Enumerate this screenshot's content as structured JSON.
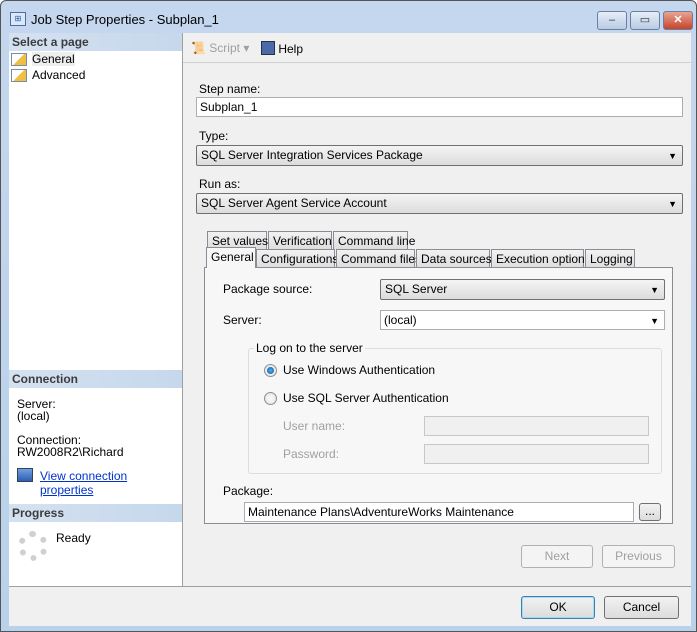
{
  "window": {
    "title": "Job Step Properties - Subplan_1",
    "controls": {
      "minimize": "–",
      "maximize": "▭",
      "close": "✕"
    }
  },
  "sidebar": {
    "select_header": "Select a page",
    "pages": [
      {
        "label": "General"
      },
      {
        "label": "Advanced"
      }
    ],
    "connection_header": "Connection",
    "server_label": "Server:",
    "server_value": "(local)",
    "connection_label": "Connection:",
    "connection_value": "RW2008R2\\Richard",
    "view_link": "View connection properties",
    "progress_header": "Progress",
    "progress_status": "Ready"
  },
  "toolbar": {
    "script": "Script",
    "help": "Help"
  },
  "form": {
    "step_name_label": "Step name:",
    "step_name_value": "Subplan_1",
    "type_label": "Type:",
    "type_value": "SQL Server Integration Services Package",
    "run_as_label": "Run as:",
    "run_as_value": "SQL Server Agent Service Account"
  },
  "tabs": {
    "row1": [
      "Set values",
      "Verification",
      "Command line"
    ],
    "row2": [
      "General",
      "Configurations",
      "Command files",
      "Data sources",
      "Execution options",
      "Logging"
    ],
    "active": "General"
  },
  "general_tab": {
    "package_source_label": "Package source:",
    "package_source_value": "SQL Server",
    "server_label": "Server:",
    "server_value": "(local)",
    "logon_group": "Log on to the server",
    "windows_auth": "Use Windows Authentication",
    "sql_auth": "Use SQL Server Authentication",
    "auth_selected": "Use Windows Authentication",
    "username_label": "User name:",
    "password_label": "Password:",
    "package_label": "Package:",
    "package_value": "Maintenance Plans\\AdventureWorks Maintenance",
    "browse": "..."
  },
  "nav_buttons": {
    "next": "Next",
    "previous": "Previous"
  },
  "dialog_buttons": {
    "ok": "OK",
    "cancel": "Cancel"
  }
}
